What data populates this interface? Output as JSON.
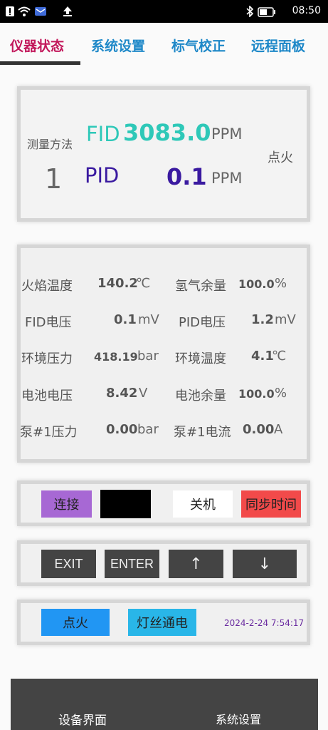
{
  "status_bar": {
    "time": "08:50"
  },
  "tabs": [
    {
      "label": "仪器状态"
    },
    {
      "label": "系统设置"
    },
    {
      "label": "标气校正"
    },
    {
      "label": "远程面板"
    }
  ],
  "measure": {
    "method_label": "测量方法",
    "method_value": "1",
    "fid_label": "FID",
    "fid_value": "3083.0",
    "fid_unit": "PPM",
    "pid_label": "PID",
    "pid_value": "0.1",
    "pid_unit": "PPM",
    "ignite_status": "点火"
  },
  "params": {
    "flame_temp_label": "火焰温度",
    "flame_temp_value": "140.2",
    "flame_temp_unit": "℃",
    "h2_label": "氢气余量",
    "h2_value": "100.0",
    "h2_unit": "%",
    "fid_v_label": "FID电压",
    "fid_v_value": "0.1",
    "fid_v_unit": "mV",
    "pid_v_label": "PID电压",
    "pid_v_value": "1.2",
    "pid_v_unit": "mV",
    "env_p_label": "环境压力",
    "env_p_value": "418.19",
    "env_p_unit": "bar",
    "env_t_label": "环境温度",
    "env_t_value": "4.1",
    "env_t_unit": "℃",
    "bat_v_label": "电池电压",
    "bat_v_value": "8.42",
    "bat_v_unit": "V",
    "bat_r_label": "电池余量",
    "bat_r_value": "100.0",
    "bat_r_unit": "%",
    "pump_p_label": "泵#1压力",
    "pump_p_value": "0.00",
    "pump_p_unit": "bar",
    "pump_i_label": "泵#1电流",
    "pump_i_value": "0.00",
    "pump_i_unit": "A"
  },
  "controls": {
    "connect": "连接",
    "shutdown": "关机",
    "sync_time": "同步时间",
    "colors": {
      "connect": "#a768d4",
      "black": "#000000",
      "sync": "#f24a4a"
    }
  },
  "keys": {
    "exit": "EXIT",
    "enter": "ENTER",
    "up": "↑",
    "down": "↓"
  },
  "ignition": {
    "ignite": "点火",
    "filament": "灯丝通电",
    "datetime": "2024-2-24 7:54:17",
    "colors": {
      "ignite": "#2196f3",
      "filament": "#29b6e8"
    }
  },
  "bottom_nav": [
    {
      "label": "设备界面"
    },
    {
      "label": "系统设置"
    }
  ]
}
